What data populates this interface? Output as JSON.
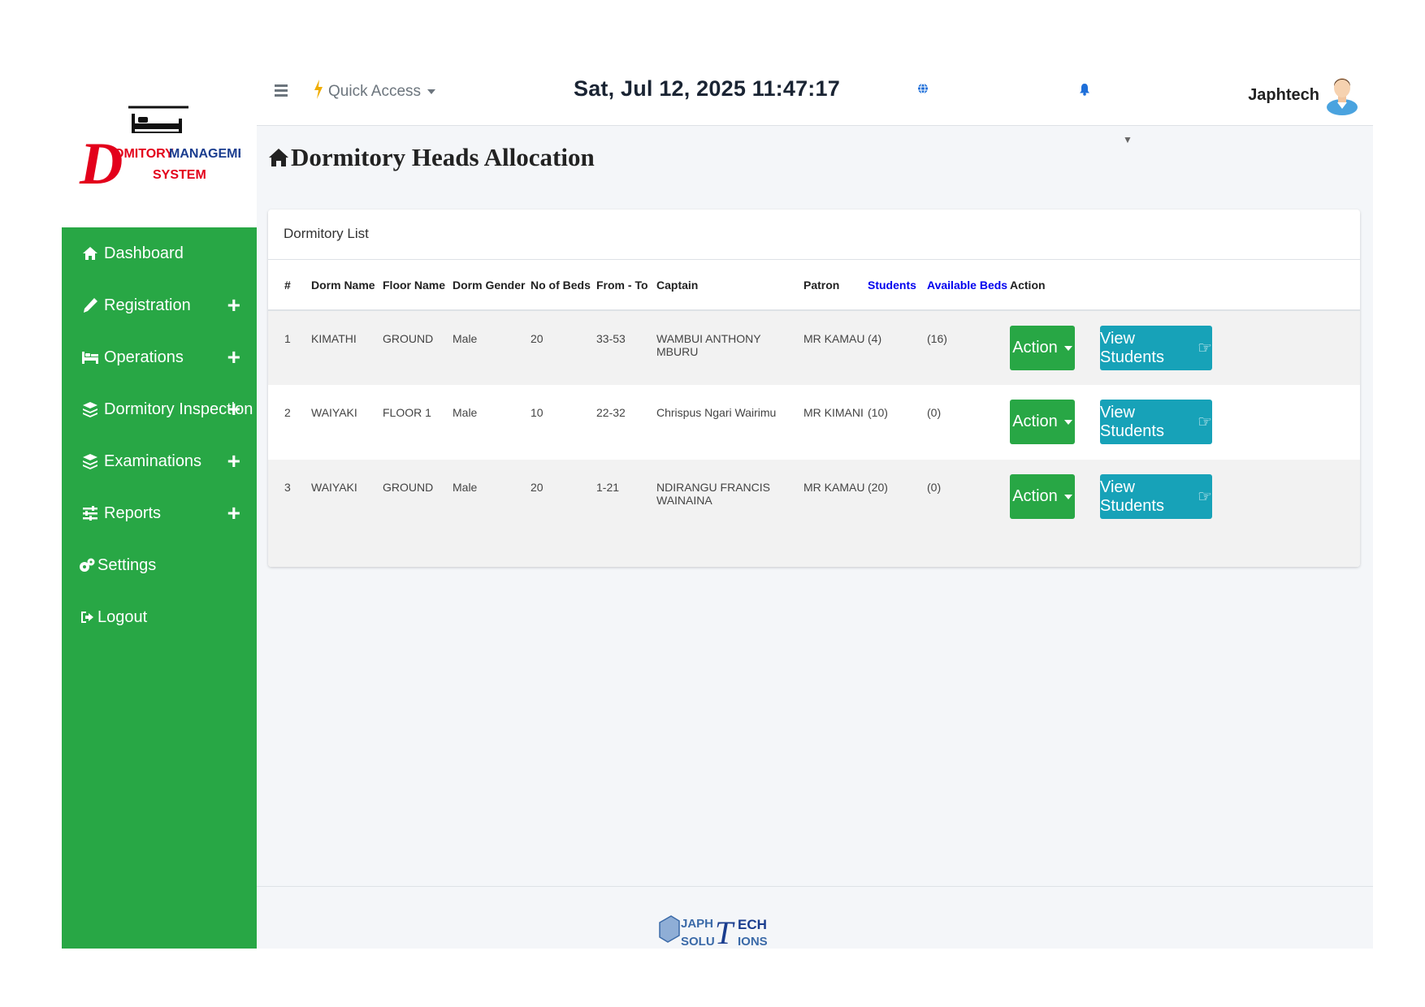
{
  "brand": {
    "logo_letter": "D",
    "logo_line1_a": "OMITORY ",
    "logo_line1_b": "MANAGEMENT",
    "logo_line2": "SYSTEM"
  },
  "sidebar": {
    "items": [
      {
        "label": "Dashboard",
        "icon": "home-icon",
        "expandable": false
      },
      {
        "label": "Registration",
        "icon": "pencil-icon",
        "expandable": true
      },
      {
        "label": "Operations",
        "icon": "bed-icon",
        "expandable": true
      },
      {
        "label": "Dormitory Inspection",
        "icon": "layers-icon",
        "expandable": true
      },
      {
        "label": "Examinations",
        "icon": "layers-icon",
        "expandable": true
      },
      {
        "label": "Reports",
        "icon": "sliders-icon",
        "expandable": true
      },
      {
        "label": "Settings",
        "icon": "gears-icon",
        "expandable": false
      },
      {
        "label": "Logout",
        "icon": "sign-out-icon",
        "expandable": false
      }
    ],
    "plus_symbol": "+"
  },
  "topbar": {
    "quick_access": "Quick Access",
    "datetime": "Sat, Jul 12, 2025 11:47:17",
    "user_name": "Japhtech"
  },
  "page": {
    "title": "Dormitory Heads Allocation"
  },
  "card": {
    "header": "Dormitory List"
  },
  "table": {
    "columns": [
      "#",
      "Dorm Name",
      "Floor Name",
      "Dorm Gender",
      "No of Beds",
      "From - To",
      "Captain",
      "Patron",
      "Students",
      "Available Beds",
      "Action"
    ],
    "rows": [
      {
        "num": "1",
        "dorm": "KIMATHI",
        "floor": "GROUND",
        "gender": "Male",
        "beds": "20",
        "range": "33-53",
        "captain": "WAMBUI ANTHONY MBURU",
        "patron": "MR KAMAU",
        "students": "(4)",
        "available": "(16)"
      },
      {
        "num": "2",
        "dorm": "WAIYAKI",
        "floor": "FLOOR 1",
        "gender": "Male",
        "beds": "10",
        "range": "22-32",
        "captain": "Chrispus Ngari Wairimu",
        "patron": "MR KIMANI",
        "students": "(10)",
        "available": "(0)"
      },
      {
        "num": "3",
        "dorm": "WAIYAKI",
        "floor": "GROUND",
        "gender": "Male",
        "beds": "20",
        "range": "1-21",
        "captain": "NDIRANGU FRANCIS WAINAINA",
        "patron": "MR KAMAU",
        "students": "(20)",
        "available": "(0)"
      }
    ],
    "action_label": "Action",
    "view_label": "View Students"
  },
  "footer": {
    "logo_a": "JAPH",
    "logo_b": "ECH",
    "logo_c": "SOLU",
    "logo_d": "IONS"
  },
  "colors": {
    "sidebar": "#28a745",
    "action_button": "#28a745",
    "view_button": "#17a2b8",
    "link_header": "#0000ee",
    "logo_red": "#e3001b",
    "logo_blue": "#1a3d8f"
  }
}
